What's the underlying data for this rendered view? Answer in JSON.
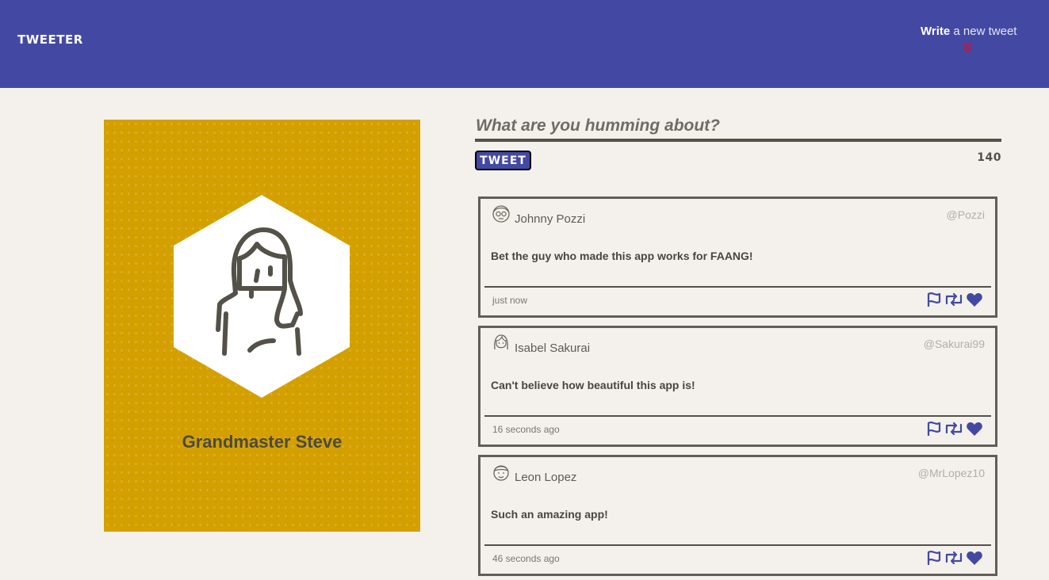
{
  "nav": {
    "brand": "TWEETER",
    "write_bold": "Write",
    "write_rest": " a new tweet",
    "accent_color": "#4349a3",
    "chevron_color": "#d0103a",
    "chevron_icon": "double-chevron-down"
  },
  "profile": {
    "name": "Grandmaster Steve",
    "background_color": "#d4a000",
    "avatar_icon": "woman-avatar"
  },
  "compose": {
    "placeholder": "What are you humming about?",
    "button_label": "TWEET",
    "counter": "140"
  },
  "tweets": [
    {
      "name": "Johnny Pozzi",
      "handle": "@Pozzi",
      "text": "Bet the guy who made this app works for FAANG!",
      "time": "just now",
      "avatar_icon": "glasses-man-avatar"
    },
    {
      "name": "Isabel Sakurai",
      "handle": "@Sakurai99",
      "text": "Can't believe how beautiful this app is!",
      "time": "16 seconds ago",
      "avatar_icon": "woman-avatar"
    },
    {
      "name": "Leon Lopez",
      "handle": "@MrLopez10",
      "text": "Such an amazing app!",
      "time": "46 seconds ago",
      "avatar_icon": "man-avatar"
    }
  ],
  "tweet_actions": [
    "flag-icon",
    "retweet-icon",
    "heart-icon"
  ]
}
